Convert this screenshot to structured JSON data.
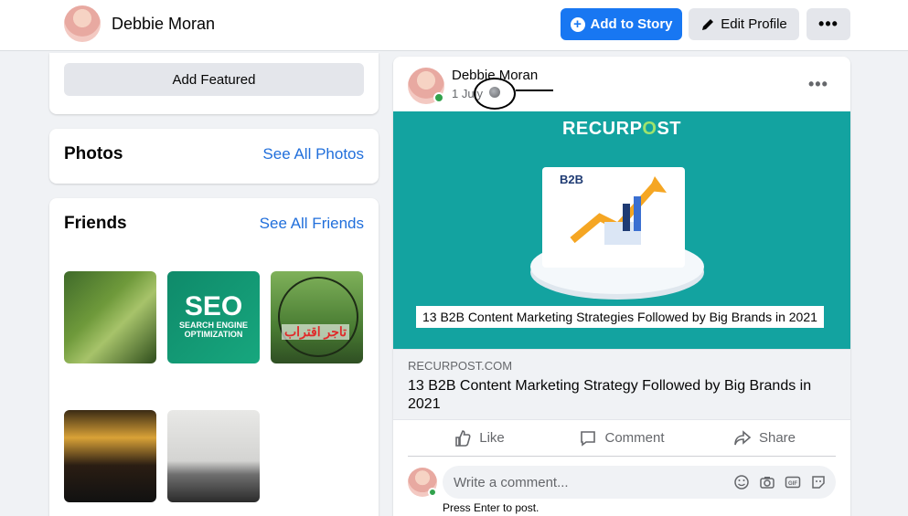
{
  "header": {
    "profile_name": "Debbie Moran",
    "add_story_label": "Add to Story",
    "edit_profile_label": "Edit Profile",
    "more_label": "•••"
  },
  "left": {
    "add_featured_label": "Add Featured",
    "photos": {
      "title": "Photos",
      "link": "See All Photos"
    },
    "friends": {
      "title": "Friends",
      "link": "See All Friends"
    },
    "friend_tiles": {
      "seo_big": "SEO",
      "seo_sub": "SEARCH ENGINE OPTIMIZATION",
      "urdu_text": "تاجر اقتراب"
    }
  },
  "post": {
    "author": "Debbie Moran",
    "date": "1 July",
    "more_label": "•••",
    "banner": {
      "logo_prefix": "RECURP",
      "logo_o": "O",
      "logo_suffix": "ST",
      "b2b_label": "B2B",
      "caption": "13 B2B Content Marketing Strategies Followed by Big Brands in 2021"
    },
    "info_label": "i",
    "link": {
      "domain": "RECURPOST.COM",
      "title": "13 B2B Content Marketing Strategy Followed by Big Brands in 2021"
    },
    "actions": {
      "like": "Like",
      "comment": "Comment",
      "share": "Share"
    },
    "comment": {
      "placeholder": "Write a comment...",
      "hint": "Press Enter to post."
    }
  },
  "colors": {
    "accent": "#1877f2",
    "banner_teal": "#13a3a0",
    "link_blue": "#216fdb",
    "online_green": "#31a24c"
  }
}
